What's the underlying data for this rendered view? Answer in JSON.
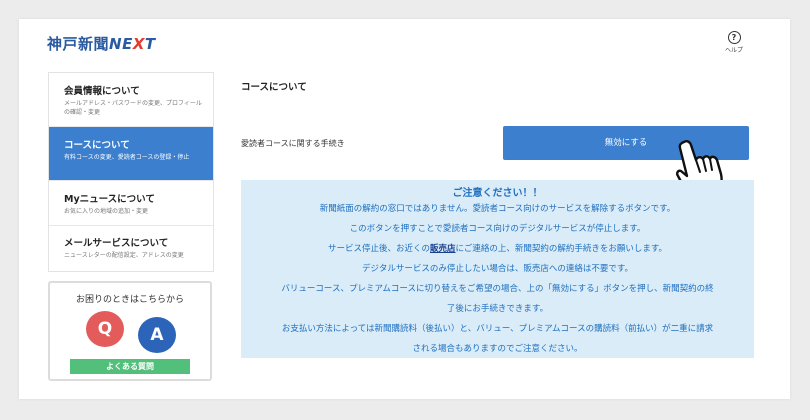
{
  "header": {
    "logo_kanji": "神戸新聞",
    "logo_next_pre": "NE",
    "logo_next_x": "X",
    "logo_next_post": "T",
    "help_label": "ヘルプ"
  },
  "sidebar": {
    "items": [
      {
        "title": "会員情報について",
        "desc": "メールアドレス・パスワードの変更、プロフィールの確認・変更"
      },
      {
        "title": "コースについて",
        "desc": "有料コースの変更、愛読者コースの登録・停止"
      },
      {
        "title": "Myニュースについて",
        "desc": "お気に入りの地域の追加・変更"
      },
      {
        "title": "メールサービスについて",
        "desc": "ニュースレターの配信設定、アドレスの変更"
      }
    ]
  },
  "faq": {
    "title": "お困りのときはこちらから",
    "q": "Q",
    "a": "A",
    "button": "よくある質問"
  },
  "main": {
    "heading": "コースについて",
    "procedure_label": "愛読者コースに関する手続き",
    "disable_button": "無効にする"
  },
  "notice": {
    "title": "ご注意ください！！",
    "line1": "新聞紙面の解約の窓口ではありません。愛読者コース向けのサービスを解除するボタンです。",
    "line2": "このボタンを押すことで愛読者コース向けのデジタルサービスが停止します。",
    "line3_pre": "サービス停止後、お近くの",
    "line3_link": "販売店",
    "line3_post": "にご連絡の上、新聞契約の解約手続きをお願いします。",
    "line4": "デジタルサービスのみ停止したい場合は、販売店への連絡は不要です。",
    "line5": "バリューコース、プレミアムコースに切り替えをご希望の場合、上の「無効にする」ボタンを押し、新聞契約の終",
    "line6": "了後にお手続きできます。",
    "line7": "お支払い方法によっては新聞購読料（後払い）と、バリュー、プレミアムコースの購読料（前払い）が二重に請求",
    "line8": "される場合もありますのでご注意ください。"
  }
}
